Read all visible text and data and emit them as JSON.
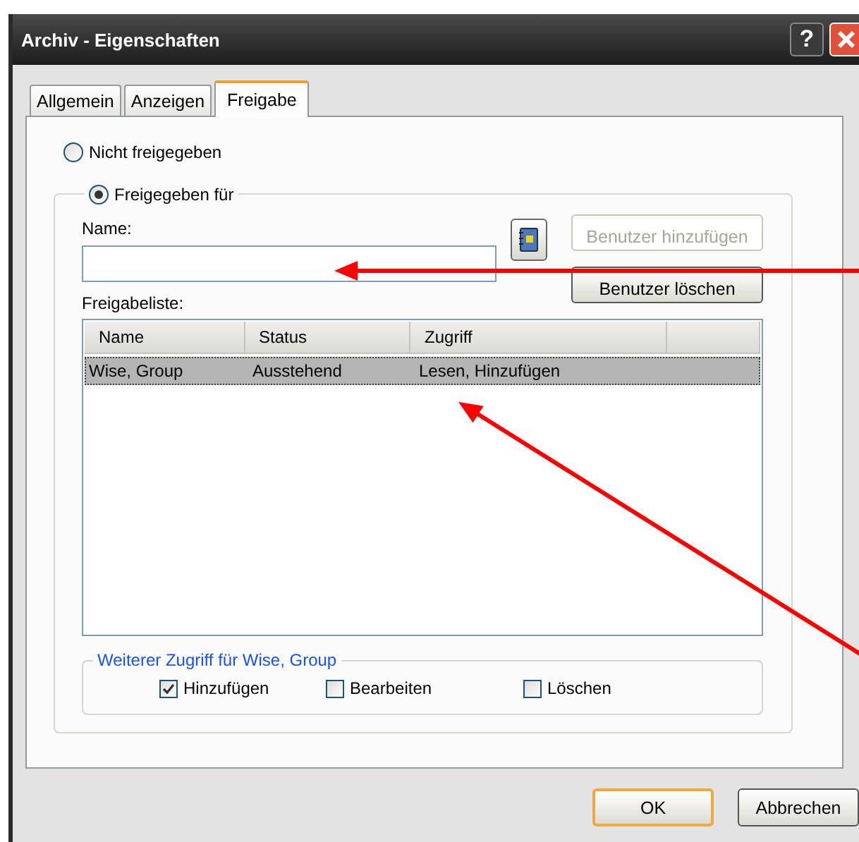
{
  "window": {
    "title": "Archiv - Eigenschaften",
    "help_button": "?"
  },
  "tabs": [
    {
      "label": "Allgemein",
      "selected": false
    },
    {
      "label": "Anzeigen",
      "selected": false
    },
    {
      "label": "Freigabe",
      "selected": true
    }
  ],
  "sharing": {
    "options": [
      {
        "label": "Nicht freigegeben",
        "selected": false
      },
      {
        "label": "Freigegeben für",
        "selected": true
      }
    ],
    "name_label": "Name:",
    "buttons": [
      {
        "label": "Benutzer hinzufügen",
        "disabled": true
      },
      {
        "label": "Benutzer löschen",
        "disabled": false
      }
    ],
    "list_label": "Freigabeliste:",
    "list": {
      "columns": [
        "Name",
        "Status",
        "Zugriff"
      ],
      "rows": [
        {
          "cells": [
            "Wise, Group",
            "Ausstehend",
            "Lesen, Hinzufügen"
          ],
          "selected": true
        }
      ]
    },
    "access_group": {
      "title": "Weiterer Zugriff für Wise, Group",
      "checkboxes": [
        {
          "label": "Hinzufügen",
          "checked": true
        },
        {
          "label": "Bearbeiten",
          "checked": false
        },
        {
          "label": "Löschen",
          "checked": false
        }
      ]
    }
  },
  "footer_buttons": [
    {
      "label": "OK",
      "default": true
    },
    {
      "label": "Abbrechen",
      "default": false
    }
  ],
  "annotations": [
    {
      "kind": "arrow"
    },
    {
      "kind": "arrow"
    }
  ]
}
